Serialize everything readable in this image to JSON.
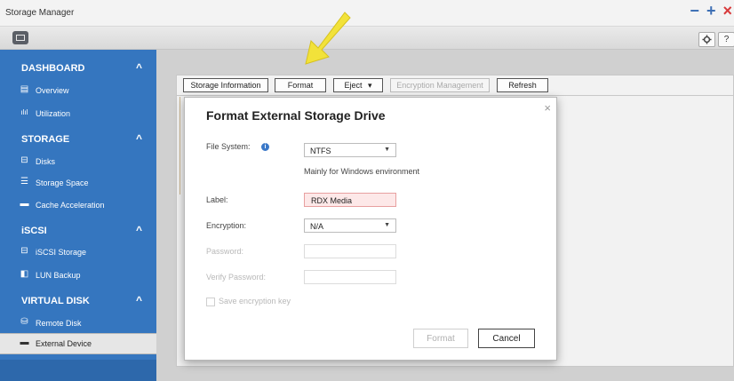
{
  "window": {
    "title": "Storage Manager",
    "controls": {
      "minimize": "−",
      "maximize": "+",
      "close": "×"
    }
  },
  "toolbar": {
    "settings_icon": "gear-icon",
    "help_label": "?"
  },
  "sidebar": {
    "sections": [
      {
        "label": "DASHBOARD",
        "chevron": "^",
        "items": [
          {
            "label": "Overview",
            "icon": "overview-icon",
            "glyph": "▤"
          },
          {
            "label": "Utilization",
            "icon": "utilization-icon",
            "glyph": "ılıl"
          }
        ]
      },
      {
        "label": "STORAGE",
        "chevron": "^",
        "items": [
          {
            "label": "Disks",
            "icon": "disks-icon",
            "glyph": "⊟"
          },
          {
            "label": "Storage Space",
            "icon": "storage-space-icon",
            "glyph": "☰"
          },
          {
            "label": "Cache Acceleration",
            "icon": "cache-acceleration-icon",
            "glyph": "▬"
          }
        ]
      },
      {
        "label": "iSCSI",
        "chevron": "^",
        "items": [
          {
            "label": "iSCSI Storage",
            "icon": "iscsi-storage-icon",
            "glyph": "⊟"
          },
          {
            "label": "LUN Backup",
            "icon": "lun-backup-icon",
            "glyph": "◧"
          }
        ]
      },
      {
        "label": "VIRTUAL DISK",
        "chevron": "^",
        "items": [
          {
            "label": "Remote Disk",
            "icon": "remote-disk-icon",
            "glyph": "⛁"
          },
          {
            "label": "External Device",
            "icon": "external-device-icon",
            "glyph": "▬",
            "selected": true
          }
        ]
      }
    ]
  },
  "actions": {
    "storage_information": "Storage Information",
    "format": "Format",
    "eject": "Eject",
    "eject_caret": "▾",
    "encryption_management": "Encryption Management",
    "refresh": "Refresh"
  },
  "dialog": {
    "title": "Format External Storage Drive",
    "close": "×",
    "file_system_label": "File System:",
    "file_system_value": "NTFS",
    "file_system_hint": "Mainly for Windows environment",
    "label_label": "Label:",
    "label_value": "RDX Media",
    "encryption_label": "Encryption:",
    "encryption_value": "N/A",
    "password_label": "Password:",
    "verify_password_label": "Verify Password:",
    "save_key_label": "Save encryption key",
    "format_button": "Format",
    "cancel_button": "Cancel"
  },
  "colors": {
    "sidebar_bg": "#3576bf",
    "selected_bg": "#e6e6e6",
    "close_red": "#d8393a",
    "accent_blue": "#3d6fb4",
    "annotation_arrow": "#f2e23a"
  }
}
